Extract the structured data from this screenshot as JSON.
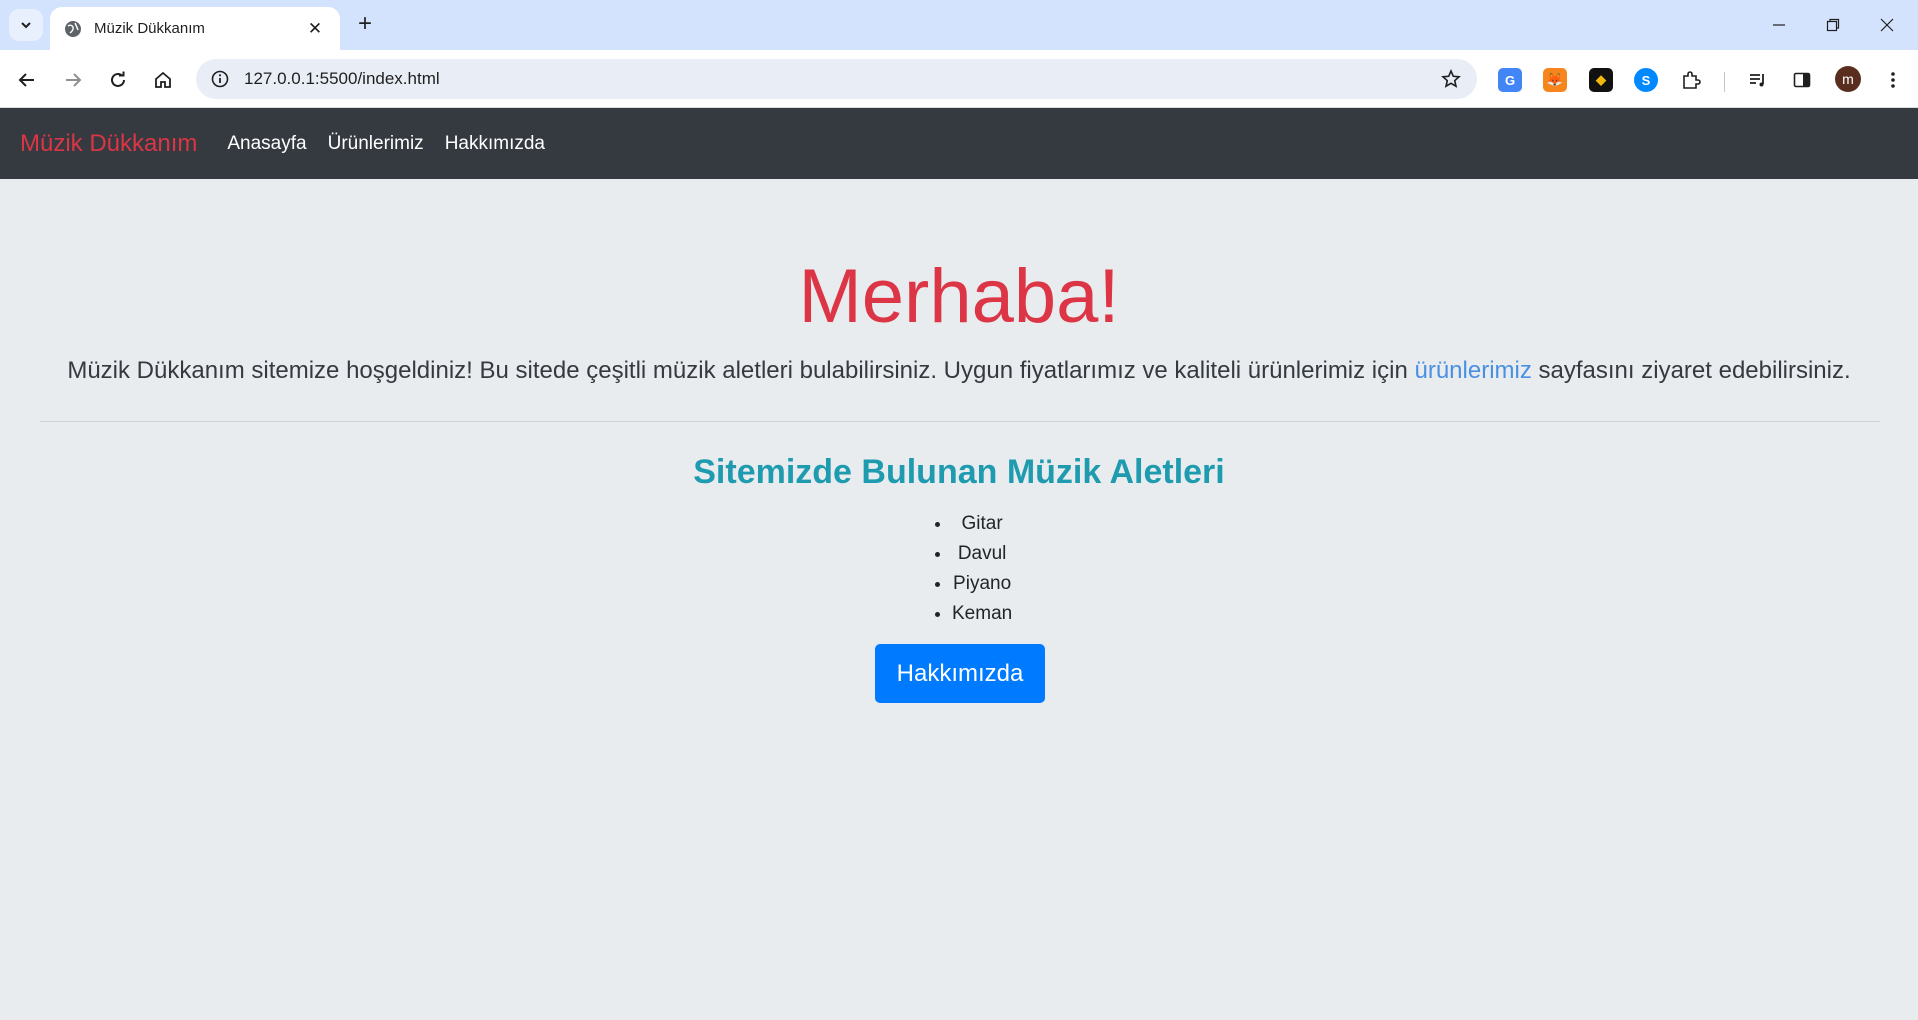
{
  "browser": {
    "tab_title": "Müzik Dükkanım",
    "url": "127.0.0.1:5500/index.html",
    "avatar_letter": "m"
  },
  "navbar": {
    "brand": "Müzik Dükkanım",
    "links": [
      "Anasayfa",
      "Ürünlerimiz",
      "Hakkımızda"
    ]
  },
  "hero": {
    "title": "Merhaba!",
    "lead_before": "Müzik Dükkanım sitemize hoşgeldiniz! Bu sitede çeşitli müzik aletleri bulabilirsiniz. Uygun fiyatlarımız ve kaliteli ürünlerimiz için ",
    "lead_link": "ürünlerimiz",
    "lead_after": " sayfasını ziyaret edebilirsiniz."
  },
  "section": {
    "title": "Sitemizde Bulunan Müzik Aletleri",
    "items": [
      "Gitar",
      "Davul",
      "Piyano",
      "Keman"
    ],
    "button_label": "Hakkımızda"
  },
  "colors": {
    "navbar_bg": "#343a40",
    "brand": "#dc3545",
    "heading": "#1f9bb0",
    "button": "#007bff",
    "page_bg": "#e9ecef"
  }
}
